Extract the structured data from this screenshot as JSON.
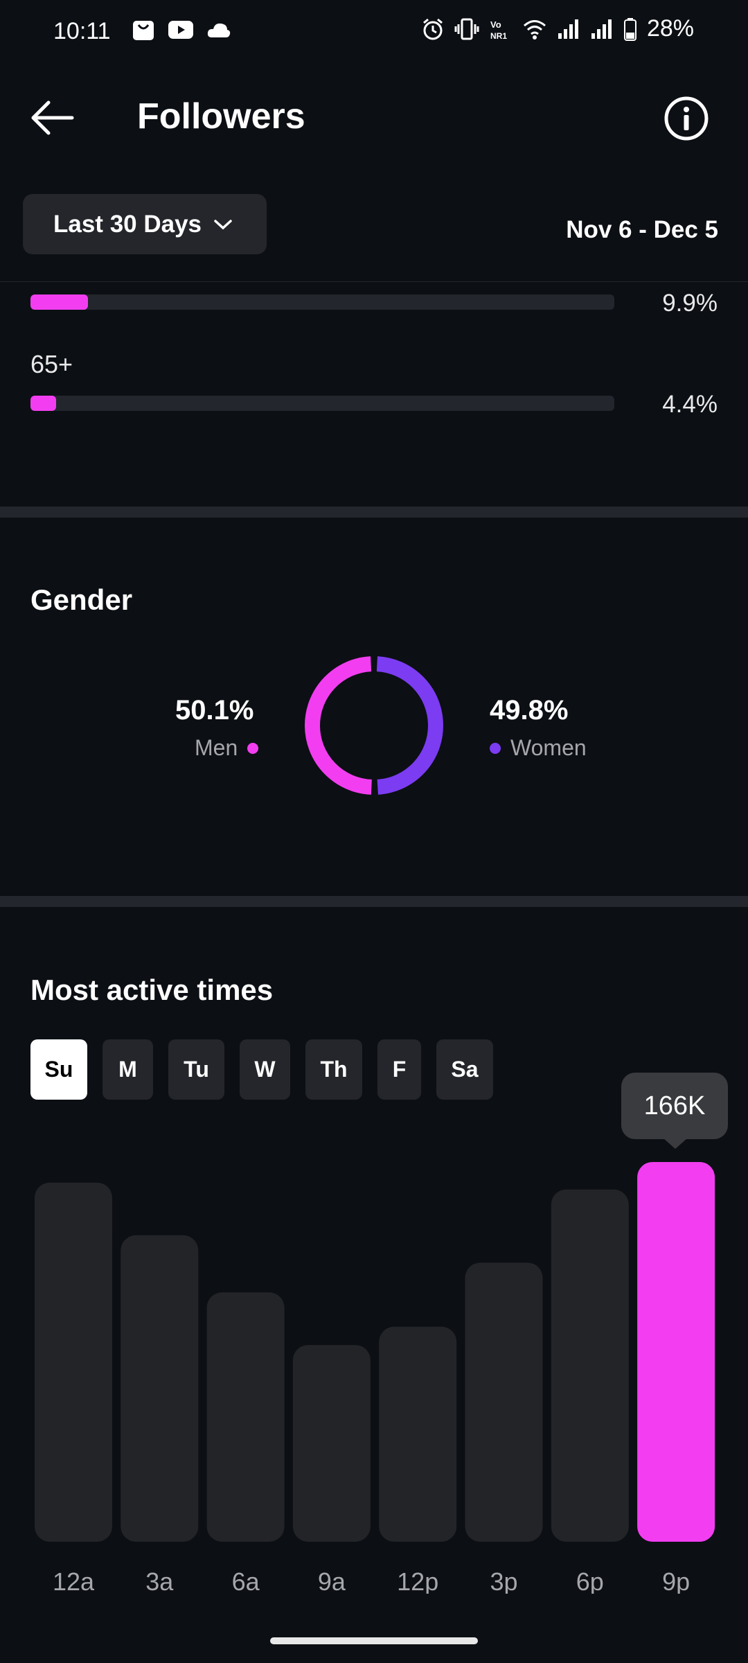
{
  "status_bar": {
    "time": "10:11",
    "battery": "28%",
    "icons": [
      "shopping-bag-icon",
      "youtube-icon",
      "cloud-icon",
      "alarm-icon",
      "vibrate-icon",
      "volte-icon",
      "wifi-icon",
      "signal-icon",
      "signal-icon",
      "battery-icon"
    ]
  },
  "header": {
    "title": "Followers"
  },
  "range": {
    "label": "Last 30 Days",
    "dates": "Nov 6 - Dec 5"
  },
  "age": {
    "rows": [
      {
        "label": "",
        "percent": "9.9%",
        "fill": 0.099
      },
      {
        "label": "65+",
        "percent": "4.4%",
        "fill": 0.044
      }
    ]
  },
  "gender": {
    "title": "Gender",
    "men": {
      "value": "50.1%",
      "label": "Men",
      "color": "#f23ef0"
    },
    "women": {
      "value": "49.8%",
      "label": "Women",
      "color": "#7c3cf2"
    }
  },
  "active_times": {
    "title": "Most active times",
    "days": [
      "Su",
      "M",
      "Tu",
      "W",
      "Th",
      "F",
      "Sa"
    ],
    "selected_day": "Su",
    "highlight_label": "166K"
  },
  "chart_data": {
    "type": "bar",
    "categories": [
      "12a",
      "3a",
      "6a",
      "9a",
      "12p",
      "3p",
      "6p",
      "9p"
    ],
    "values": [
      157,
      134,
      109,
      86,
      94,
      122,
      154,
      166
    ],
    "highlight_index": 7,
    "highlight_color": "#f23ef0",
    "bar_color": "#232428"
  }
}
